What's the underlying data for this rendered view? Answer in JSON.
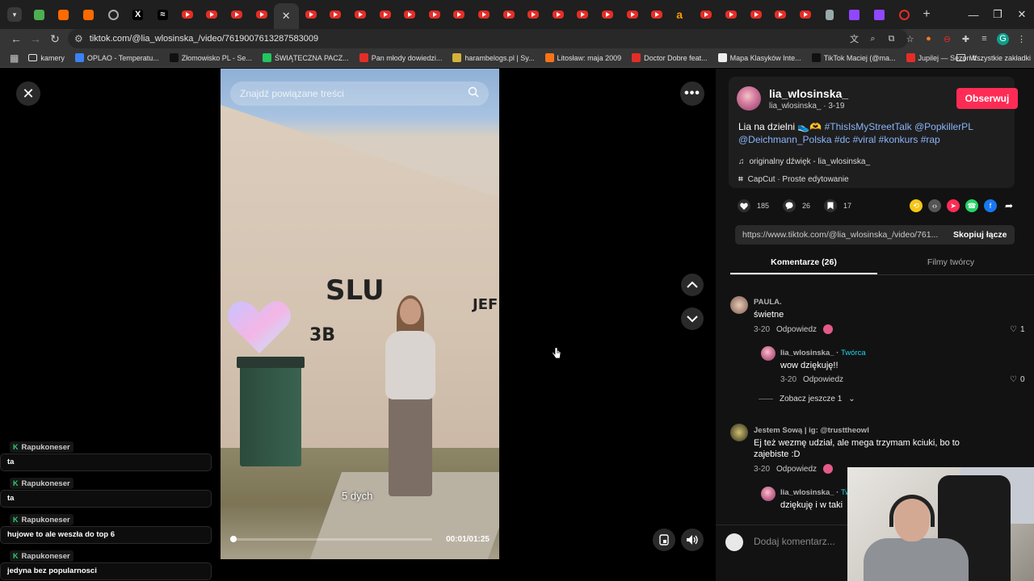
{
  "browser": {
    "tabs": [
      {
        "type": "chk"
      },
      {
        "type": "org"
      },
      {
        "type": "org"
      },
      {
        "type": "globe"
      },
      {
        "type": "blk",
        "glyph": "X"
      },
      {
        "type": "blk",
        "glyph": "≈"
      },
      {
        "type": "yt"
      },
      {
        "type": "yt"
      },
      {
        "type": "yt"
      },
      {
        "type": "yt"
      },
      {
        "type": "active"
      },
      {
        "type": "yt"
      },
      {
        "type": "yt"
      },
      {
        "type": "yt"
      },
      {
        "type": "yt"
      },
      {
        "type": "yt"
      },
      {
        "type": "yt"
      },
      {
        "type": "yt"
      },
      {
        "type": "yt"
      },
      {
        "type": "yt"
      },
      {
        "type": "yt"
      },
      {
        "type": "yt"
      },
      {
        "type": "yt"
      },
      {
        "type": "yt"
      },
      {
        "type": "yt"
      },
      {
        "type": "yt"
      },
      {
        "type": "amz",
        "glyph": "a"
      },
      {
        "type": "yt"
      },
      {
        "type": "yt"
      },
      {
        "type": "yt"
      },
      {
        "type": "yt"
      },
      {
        "type": "yt"
      },
      {
        "type": "doc"
      },
      {
        "type": "twitch"
      },
      {
        "type": "twitch"
      },
      {
        "type": "rec"
      }
    ],
    "new_tab": "+",
    "url": "tiktok.com/@lia_wlosinska_/video/7619007613287583009",
    "bookmarks": [
      {
        "label": "kamery",
        "color": "#e5e5e5",
        "kind": "folder"
      },
      {
        "label": "OPLAO - Temperatu...",
        "color": "#3b82f6"
      },
      {
        "label": "Złomowisko PL - Se...",
        "color": "#111111"
      },
      {
        "label": "ŚWIĄTECZNA PACZ...",
        "color": "#22c55e"
      },
      {
        "label": "Pan młody dowiedzi...",
        "color": "#e52d27"
      },
      {
        "label": "harambelogs.pl | Sy...",
        "color": "#d4b23a"
      },
      {
        "label": "Litosław: maja 2009",
        "color": "#f97316"
      },
      {
        "label": "Doctor Dobre feat...",
        "color": "#e52d27"
      },
      {
        "label": "Mapa Klasyków Inte...",
        "color": "#eeeeee"
      },
      {
        "label": "TikTok Maciej (@ma...",
        "color": "#111111"
      },
      {
        "label": "Jupilej — Sezon ft...",
        "color": "#e52d27"
      }
    ],
    "all_bookmarks": "Wszystkie zakładki"
  },
  "video": {
    "search_placeholder": "Znajdź powiązane treści",
    "caption": "5 dych",
    "time": "00:01/01:25",
    "progress": 0.012,
    "graffiti": [
      "SLU",
      "JEF",
      "3B"
    ]
  },
  "author": {
    "name": "lia_wlosinska_",
    "handle_date": "lia_wlosinska_ · 3-19",
    "follow": "Obserwuj",
    "desc_text": "Lia na dzielni 👟🫶 ",
    "desc_tags": [
      "#ThisIsMyStreetTalk",
      "@PopkillerPL",
      "@Deichmann_Polska",
      "#dc",
      "#viral",
      "#konkurs",
      "#rap"
    ],
    "sound": "originalny dźwięk - lia_wlosinska_",
    "capcut": "CapCut · Proste edytowanie"
  },
  "stats": {
    "likes": "185",
    "comments": "26",
    "saves": "17"
  },
  "share_colors": [
    "#f5c518",
    "#555555",
    "#fe2c55",
    "#25d366",
    "#1877f2"
  ],
  "link": {
    "url": "https://www.tiktok.com/@lia_wlosinska_/video/761...",
    "copy": "Skopiuj łącze"
  },
  "tabs": {
    "comments": "Komentarze (26)",
    "creator": "Filmy twórcy"
  },
  "comments": [
    {
      "name": "PAULA.",
      "text": "świetne",
      "date": "3-20",
      "reply": "Odpowiedz",
      "likes": "1"
    },
    {
      "name": "lia_wlosinska_",
      "badge": "Twórca",
      "text": "wow dziękuję!!",
      "date": "3-20",
      "reply": "Odpowiedz",
      "likes": "0"
    },
    {
      "name": "Jestem Sową | ig: @trusttheowl",
      "text": "Ej też wezmę udział, ale mega trzymam kciuki, bo to zajebiste :D",
      "date": "3-20",
      "reply": "Odpowiedz"
    },
    {
      "name": "lia_wlosinska_",
      "badge": "Tw",
      "text": "dziękuję i w taki"
    }
  ],
  "more_replies": "Zobacz jeszcze 1",
  "add_comment": "Dodaj komentarz...",
  "chat": [
    {
      "user": "Rapukoneser",
      "text": "ta"
    },
    {
      "user": "Rapukoneser",
      "text": "ta"
    },
    {
      "user": "Rapukoneser",
      "text": "hujowe to ale weszła do top 6"
    },
    {
      "user": "Rapukoneser",
      "text": "jedyna bez popularnosci"
    }
  ]
}
